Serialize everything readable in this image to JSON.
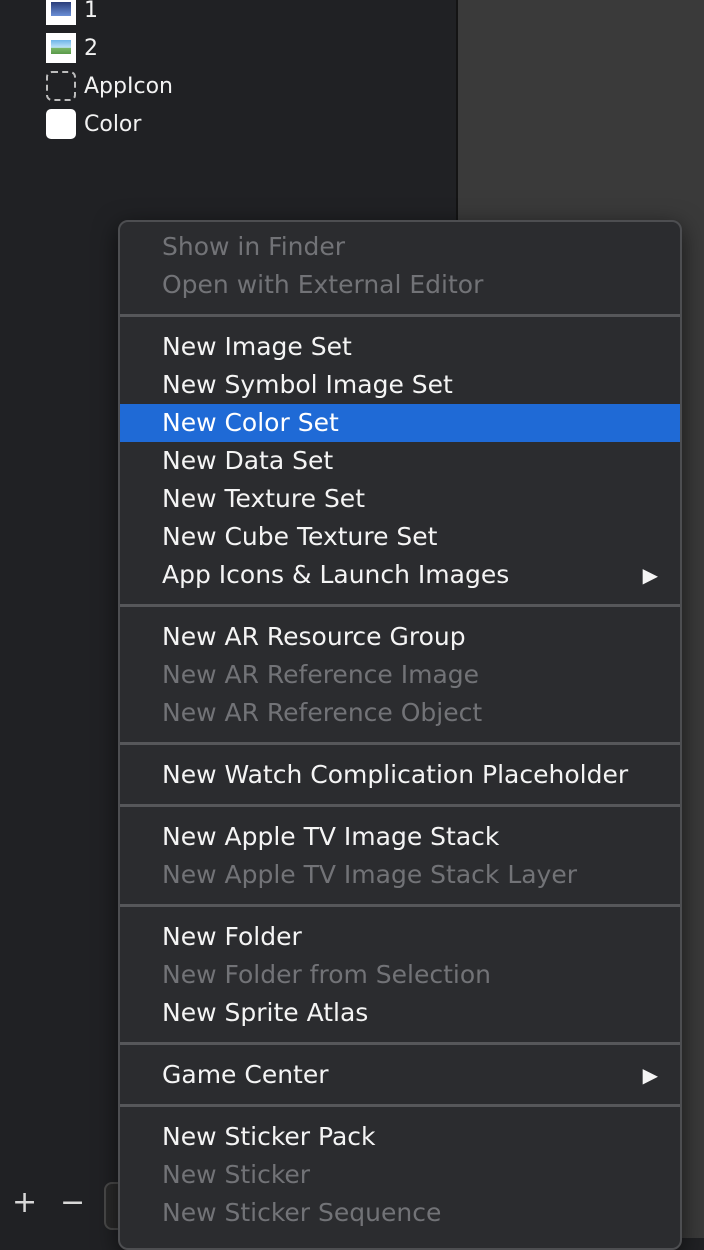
{
  "navigator": {
    "assets": [
      {
        "label": "1",
        "icon": "image-thumbnail-icon"
      },
      {
        "label": "2",
        "icon": "image-thumbnail-icon"
      },
      {
        "label": "AppIcon",
        "icon": "appicon-placeholder-icon"
      },
      {
        "label": "Color",
        "icon": "color-swatch-icon"
      }
    ]
  },
  "toolbar": {
    "add_label": "+",
    "remove_label": "−"
  },
  "menu": {
    "show_in_finder": "Show in Finder",
    "open_external": "Open with External Editor",
    "new_image_set": "New Image Set",
    "new_symbol_image_set": "New Symbol Image Set",
    "new_color_set": "New Color Set",
    "new_data_set": "New Data Set",
    "new_texture_set": "New Texture Set",
    "new_cube_texture_set": "New Cube Texture Set",
    "app_icons_launch": "App Icons & Launch Images",
    "new_ar_resource_group": "New AR Resource Group",
    "new_ar_reference_image": "New AR Reference Image",
    "new_ar_reference_object": "New AR Reference Object",
    "new_watch_complication": "New Watch Complication Placeholder",
    "new_apple_tv_image_stack": "New Apple TV Image Stack",
    "new_apple_tv_image_stack_layer": "New Apple TV Image Stack Layer",
    "new_folder": "New Folder",
    "new_folder_from_selection": "New Folder from Selection",
    "new_sprite_atlas": "New Sprite Atlas",
    "game_center": "Game Center",
    "new_sticker_pack": "New Sticker Pack",
    "new_sticker": "New Sticker",
    "new_sticker_sequence": "New Sticker Sequence",
    "submenu_arrow": "▶"
  },
  "colors": {
    "selection": "#1f6ad6",
    "menu_background": "#2b2c2f",
    "disabled_text": "#727377"
  }
}
